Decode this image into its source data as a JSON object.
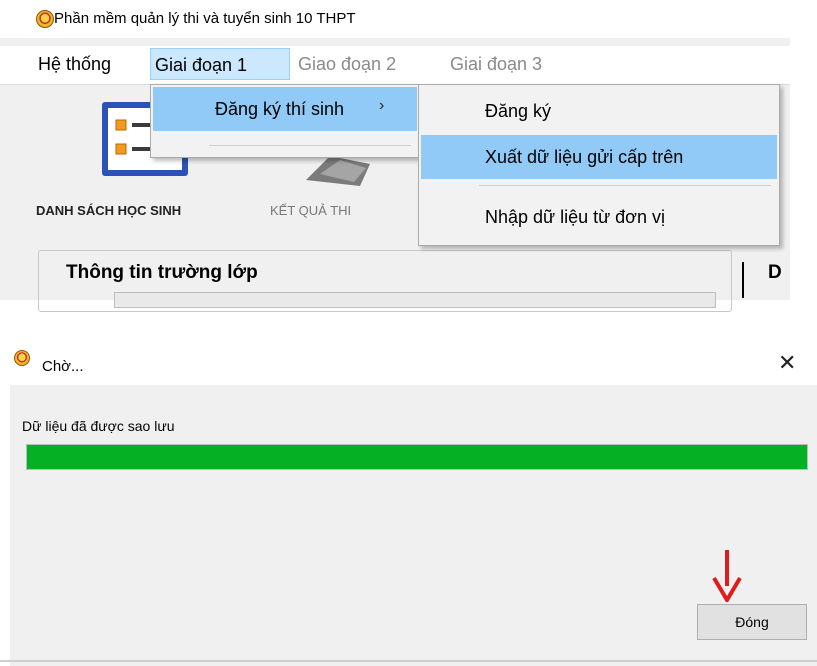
{
  "app": {
    "title": "Phần mềm quản lý thi và tuyển sinh 10 THPT",
    "menubar": [
      "Hệ thống",
      "Giai đoạn 1",
      "Giao đoạn 2",
      "Giai đoạn 3"
    ],
    "toolbar": {
      "students_label": "DANH SÁCH HỌC SINH",
      "results_label": "KẾT QUẢ THI"
    },
    "group": {
      "title": "Thông tin trường lớp",
      "right_title_partial": "D"
    },
    "menu_giaidoan1": {
      "items": [
        "Đăng ký thí sinh"
      ],
      "submenu_arrow": "›"
    },
    "menu_dangky": {
      "items": [
        "Đăng ký",
        "Xuất dữ liệu gửi cấp trên",
        "Nhập dữ liệu từ đơn vị"
      ],
      "highlighted_index": 1
    }
  },
  "dialog": {
    "title": "Chờ...",
    "close_glyph": "✕",
    "message": "Dữ liệu đã được sao lưu",
    "progress": 1.0,
    "progress_color": "#06b025",
    "button_label": "Đóng",
    "annotation_arrow_color": "#e01b1b"
  },
  "colors": {
    "menu_open": "#cce8ff",
    "menu_highlight": "#91c9f7"
  },
  "icons": [
    "app-logo-icon",
    "student-list-icon",
    "exam-results-icon",
    "submenu-arrow-icon",
    "close-icon",
    "red-arrow-icon"
  ]
}
